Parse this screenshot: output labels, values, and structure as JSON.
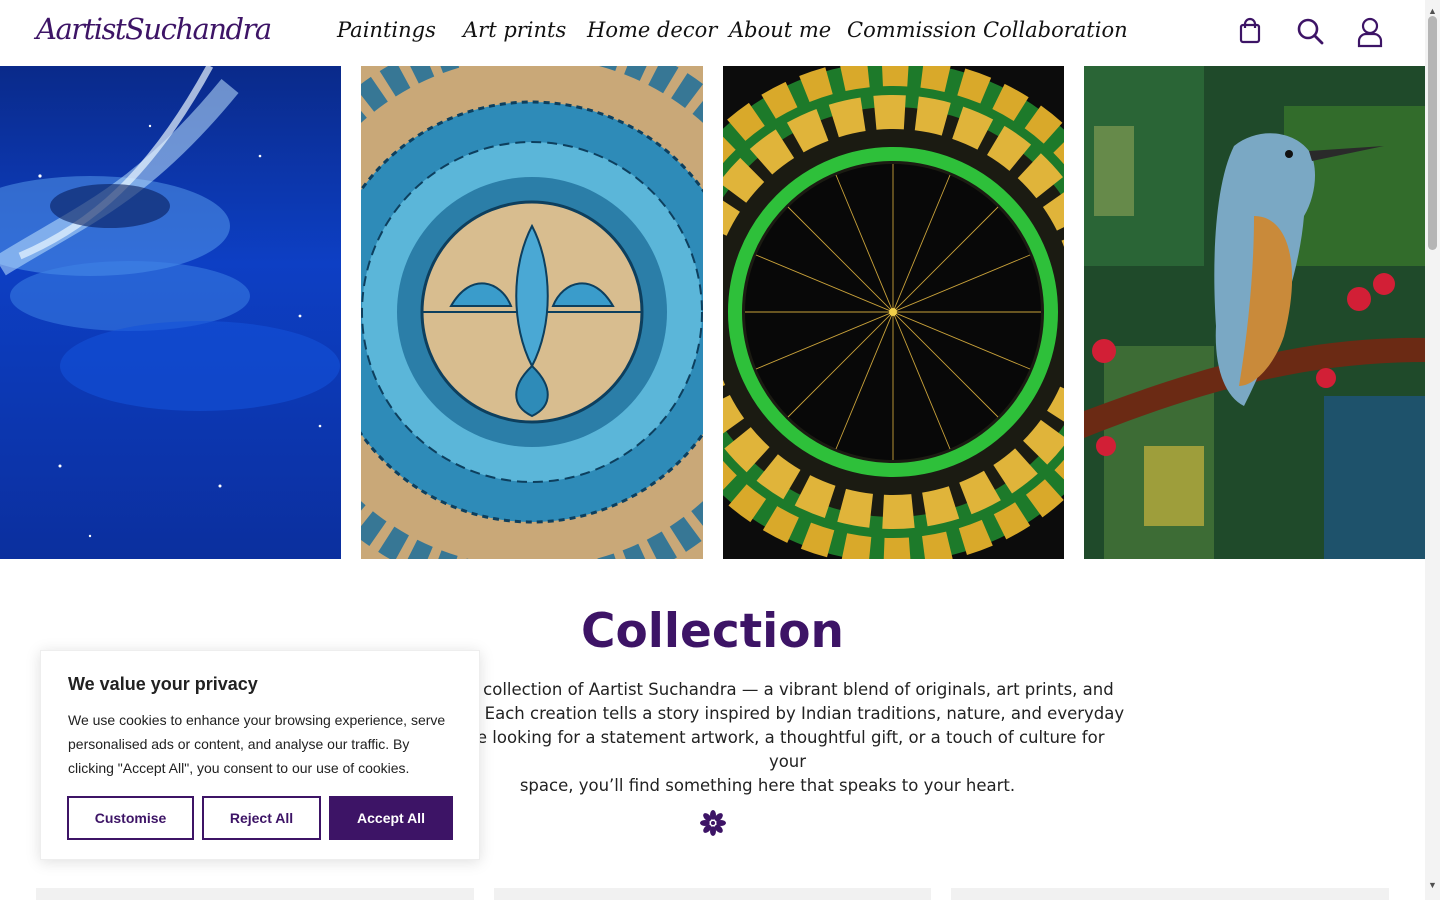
{
  "header": {
    "logo_text": "AartistSuchandra",
    "nav": [
      {
        "label": "Paintings"
      },
      {
        "label": "Art prints"
      },
      {
        "label": "Home decor"
      },
      {
        "label": "About me"
      },
      {
        "label": "Commission"
      },
      {
        "label": "Collaboration"
      }
    ],
    "icons": [
      "shopping-bag-icon",
      "search-icon",
      "user-icon"
    ]
  },
  "gallery": {
    "panels": [
      "night-sky-painting",
      "blue-mandala-on-wood",
      "green-gold-mandala-on-black",
      "kingfisher-painting"
    ]
  },
  "collection": {
    "title": "Collection",
    "lines": [
      "te collection of Aartist Suchandra — a vibrant blend of originals, art prints, and",
      "les. Each creation tells a story inspired by Indian traditions, nature, and everyday",
      "re looking for a statement artwork, a thoughtful gift, or a touch of culture for your",
      "space, you’ll find something here that speaks to your heart."
    ]
  },
  "cookie_banner": {
    "title": "We value your privacy",
    "text": "We use cookies to enhance your browsing experience, serve personalised ads or content, and analyse our traffic. By clicking \"Accept All\", you consent to our use of cookies.",
    "buttons": {
      "customise": "Customise",
      "reject": "Reject All",
      "accept": "Accept All"
    }
  },
  "colors": {
    "brand": "#3d1466",
    "text": "#222222"
  }
}
